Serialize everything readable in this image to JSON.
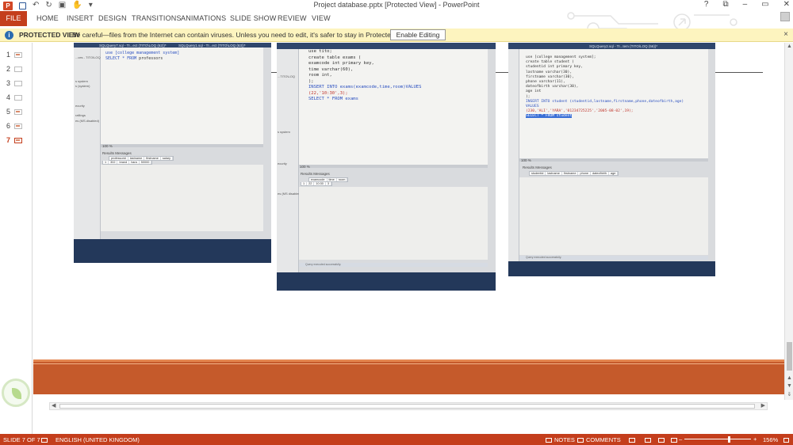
{
  "window": {
    "title": "Project database.pptx [Protected View] - PowerPoint",
    "controls": [
      "?",
      "⧉",
      "–",
      "▭",
      "✕"
    ]
  },
  "quick_access": {
    "app_icon": "powerpoint-logo",
    "app_letter": "P",
    "icons": [
      "save-icon",
      "undo-icon",
      "redo-icon",
      "start-from-beginning-icon",
      "touch-mouse-mode-icon",
      "customize-icon"
    ]
  },
  "ribbon": {
    "file_label": "FILE",
    "tabs": [
      "HOME",
      "INSERT",
      "DESIGN",
      "TRANSITIONS",
      "ANIMATIONS",
      "SLIDE SHOW",
      "REVIEW",
      "VIEW"
    ]
  },
  "protected_view": {
    "title": "PROTECTED VIEW",
    "message": "Be careful—files from the Internet can contain viruses. Unless you need to edit, it's safer to stay in Protected View.",
    "button": "Enable Editing",
    "close": "×"
  },
  "thumbnails": {
    "numbers": [
      "1",
      "2",
      "3",
      "4",
      "5",
      "6",
      "7"
    ],
    "active_index": 7
  },
  "photos": [
    {
      "tab_left": "SQLQuery7.sql - TI...ect (TITO\\LOQ (62))*",
      "tab_right": "SQLQuery1.sql - TI...ect (TITO\\LOQ (63))*",
      "side": [
        "...ces - TITO\\LOQ",
        "s system",
        "s (system)",
        "ecurity",
        "rafiings",
        "es (MS.disabled)"
      ],
      "code_1": "use [college management system]",
      "code_2_kw": "SELECT * FROM",
      "code_2_rest": " professors",
      "zoom": "100 %",
      "results_tabs": "Results  Messages",
      "columns": [
        "professorid",
        "lastname",
        "firstname",
        "salary"
      ],
      "row": [
        "1",
        "302",
        "brand",
        "hara",
        "50000"
      ]
    },
    {
      "code_lines_kw": [
        "use",
        "create table",
        "int primary key,",
        "varchar",
        "int,",
        "INSERT INTO",
        "SELECT * FROM"
      ],
      "code_1": "use tito;",
      "code_2": "create table exams (",
      "code_3": "examcode int primary key,",
      "code_4": "time varchar(60),",
      "code_5": "room int,",
      "code_6": ");",
      "code_7": "INSERT INTO exams(examcode,time,room)VALUES",
      "code_8": "(22,'10:30',3);",
      "code_9": "SELECT * FROM exams",
      "side": [
        "...TITO\\LOQ",
        "s system",
        "ecurity",
        "es (MS disabled)"
      ],
      "zoom": "100 %",
      "results_tabs": "Results  Messages",
      "columns": [
        "examcode",
        "time",
        "room"
      ],
      "row": [
        "1",
        "22",
        "10:30",
        "3"
      ],
      "status": "Query executed successfully."
    },
    {
      "tab": "SQLQuery2.sql - TI...tem (TITO\\LOQ (56))*",
      "code_1": "use [college management system];",
      "code_2": "create table student (",
      "code_3": "studentid int primary key,",
      "code_4": "lastname varchar(30),",
      "code_5": "firstname varchar(30),",
      "code_6": "phone varchar(11),",
      "code_7": "dateofbirth varchar(30),",
      "code_8": "age int",
      "code_9": ");",
      "code_10": "INSERT INTO student (studentid,lastname,firstname,phone,dateofbirth,age)",
      "code_11": "VALUES",
      "code_12": "(230,'ALI','YARA','01234725225','2005-08-02',19);",
      "code_13": "SELECT * FROM student",
      "zoom": "100 %",
      "results_tabs": "Results  Messages",
      "columns": [
        "studentid",
        "lastname",
        "firstname",
        "phone",
        "dateofbirth",
        "age"
      ],
      "status": "Query executed successfully."
    }
  ],
  "statusbar": {
    "slide": "SLIDE 7 OF 7",
    "language": "ENGLISH (UNITED KINGDOM)",
    "notes": "NOTES",
    "comments": "COMMENTS",
    "zoom": "156%",
    "zoom_minus": "–",
    "zoom_plus": "+"
  },
  "colors": {
    "accent": "#c43e1c",
    "protected_bar": "#fdf4bf",
    "footer_band": "#c55a2b"
  }
}
